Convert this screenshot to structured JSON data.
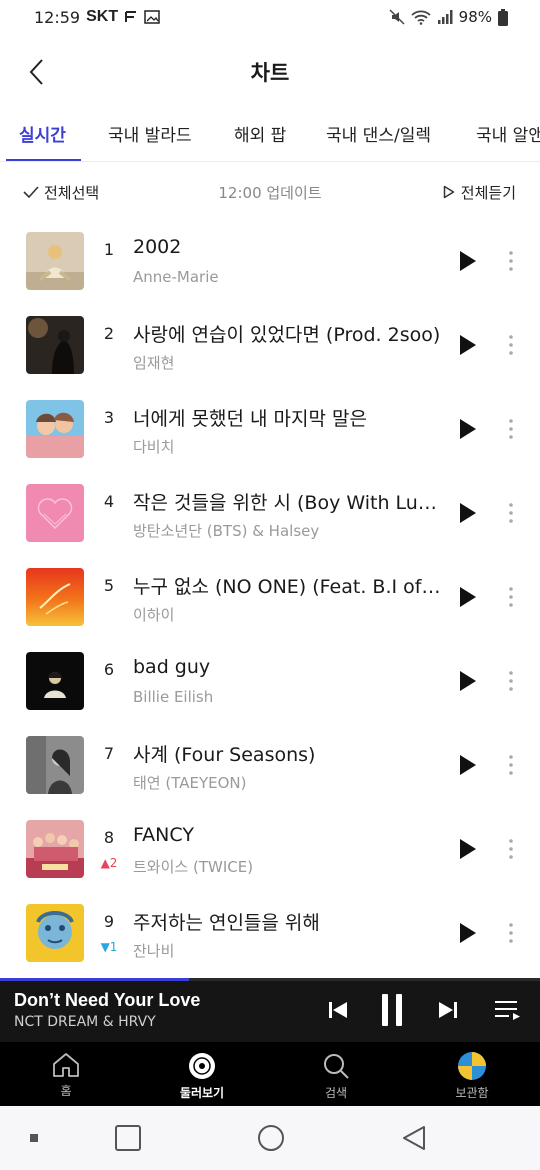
{
  "status_bar": {
    "time": "12:59",
    "carrier": "SKT",
    "battery": "98%"
  },
  "header": {
    "title": "차트"
  },
  "tabs": [
    {
      "label": "실시간",
      "active": true
    },
    {
      "label": "국내 발라드",
      "active": false
    },
    {
      "label": "해외 팝",
      "active": false
    },
    {
      "label": "국내 댄스/일렉",
      "active": false
    },
    {
      "label": "국내 알앤",
      "active": false
    }
  ],
  "toolbar": {
    "select_all": "전체선택",
    "update_time": "12:00 업데이트",
    "play_all": "전체듣기"
  },
  "songs": [
    {
      "rank": "1",
      "change": "",
      "title": "2002",
      "artist": "Anne-Marie"
    },
    {
      "rank": "2",
      "change": "",
      "title": "사랑에 연습이 있었다면 (Prod. 2soo)",
      "artist": "임재현"
    },
    {
      "rank": "3",
      "change": "",
      "title": "너에게 못했던 내 마지막 말은",
      "artist": "다비치"
    },
    {
      "rank": "4",
      "change": "",
      "title": "작은 것들을 위한 시 (Boy With Luv…",
      "artist": "방탄소년단 (BTS) & Halsey"
    },
    {
      "rank": "5",
      "change": "",
      "title": "누구 없소 (NO ONE) (Feat. B.I of i…",
      "artist": "이하이"
    },
    {
      "rank": "6",
      "change": "",
      "title": "bad guy",
      "artist": "Billie Eilish"
    },
    {
      "rank": "7",
      "change": "",
      "title": "사계 (Four Seasons)",
      "artist": "태연 (TAEYEON)"
    },
    {
      "rank": "8",
      "change": "▲2",
      "change_dir": "up",
      "title": "FANCY",
      "artist": "트와이스 (TWICE)"
    },
    {
      "rank": "9",
      "change": "▼1",
      "change_dir": "down",
      "title": "주저하는 연인들을 위해",
      "artist": "잔나비"
    }
  ],
  "now_playing": {
    "title": "Don’t Need Your Love",
    "artist": "NCT DREAM & HRVY",
    "progress": 0.35
  },
  "bottom_nav": [
    {
      "label": "홈",
      "icon": "home-icon",
      "active": false
    },
    {
      "label": "둘러보기",
      "icon": "browse-disc-icon",
      "active": true
    },
    {
      "label": "검색",
      "icon": "search-icon",
      "active": false
    },
    {
      "label": "보관함",
      "icon": "library-avatar-icon",
      "active": false
    }
  ],
  "colors": {
    "accent": "#3b3fd8",
    "rank_up": "#e8455a",
    "rank_down": "#2aa7e0",
    "player_bg": "#151515"
  }
}
